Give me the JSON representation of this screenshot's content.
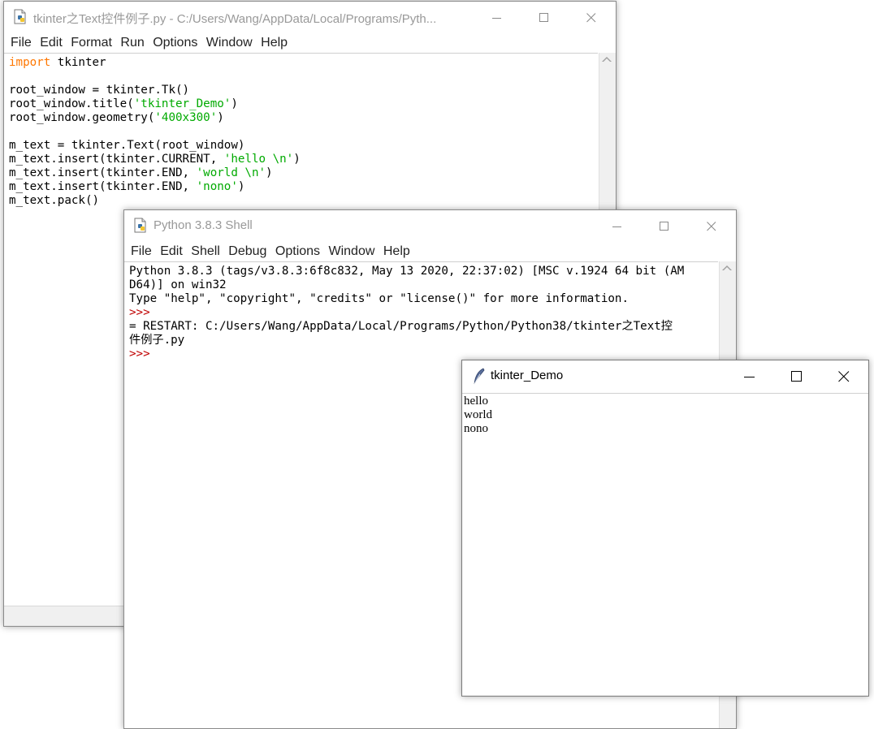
{
  "editor": {
    "title": "tkinter之Text控件例子.py - C:/Users/Wang/AppData/Local/Programs/Pyth...",
    "menu": [
      "File",
      "Edit",
      "Format",
      "Run",
      "Options",
      "Window",
      "Help"
    ],
    "code_lines": [
      [
        {
          "t": "import",
          "c": "kw"
        },
        {
          "t": " tkinter",
          "c": ""
        }
      ],
      [],
      [
        {
          "t": "root_window = tkinter.Tk()",
          "c": ""
        }
      ],
      [
        {
          "t": "root_window.title(",
          "c": ""
        },
        {
          "t": "'tkinter_Demo'",
          "c": "str"
        },
        {
          "t": ")",
          "c": ""
        }
      ],
      [
        {
          "t": "root_window.geometry(",
          "c": ""
        },
        {
          "t": "'400x300'",
          "c": "str"
        },
        {
          "t": ")",
          "c": ""
        }
      ],
      [],
      [
        {
          "t": "m_text = tkinter.Text(root_window)",
          "c": ""
        }
      ],
      [
        {
          "t": "m_text.insert(tkinter.CURRENT, ",
          "c": ""
        },
        {
          "t": "'hello \\n'",
          "c": "str"
        },
        {
          "t": ")",
          "c": ""
        }
      ],
      [
        {
          "t": "m_text.insert(tkinter.END, ",
          "c": ""
        },
        {
          "t": "'world \\n'",
          "c": "str"
        },
        {
          "t": ")",
          "c": ""
        }
      ],
      [
        {
          "t": "m_text.insert(tkinter.END, ",
          "c": ""
        },
        {
          "t": "'nono'",
          "c": "str"
        },
        {
          "t": ")",
          "c": ""
        }
      ],
      [
        {
          "t": "m_text.pack()",
          "c": ""
        }
      ]
    ]
  },
  "shell": {
    "title": "Python 3.8.3 Shell",
    "menu": [
      "File",
      "Edit",
      "Shell",
      "Debug",
      "Options",
      "Window",
      "Help"
    ],
    "lines": [
      [
        {
          "t": "Python 3.8.3 (tags/v3.8.3:6f8c832, May 13 2020, 22:37:02) [MSC v.1924 64 bit (AM",
          "c": ""
        }
      ],
      [
        {
          "t": "D64)] on win32",
          "c": ""
        }
      ],
      [
        {
          "t": "Type \"help\", \"copyright\", \"credits\" or \"license()\" for more information.",
          "c": ""
        }
      ],
      [
        {
          "t": ">>>",
          "c": "prompt"
        }
      ],
      [
        {
          "t": "= RESTART: C:/Users/Wang/AppData/Local/Programs/Python/Python38/tkinter之Text控",
          "c": ""
        }
      ],
      [
        {
          "t": "件例子.py",
          "c": ""
        }
      ],
      [
        {
          "t": ">>>",
          "c": "prompt"
        }
      ]
    ]
  },
  "demo": {
    "title": "tkinter_Demo",
    "text_lines": [
      "hello",
      "world",
      "nono"
    ]
  },
  "icons": {
    "minimize": "minimize-icon",
    "maximize": "maximize-icon",
    "close": "close-icon",
    "idle_file": "idle-file-icon",
    "tk_feather": "tk-feather-icon"
  },
  "colors": {
    "keyword": "#ff7700",
    "string": "#00aa00",
    "prompt": "#c00000",
    "inactive_title": "#999999"
  }
}
